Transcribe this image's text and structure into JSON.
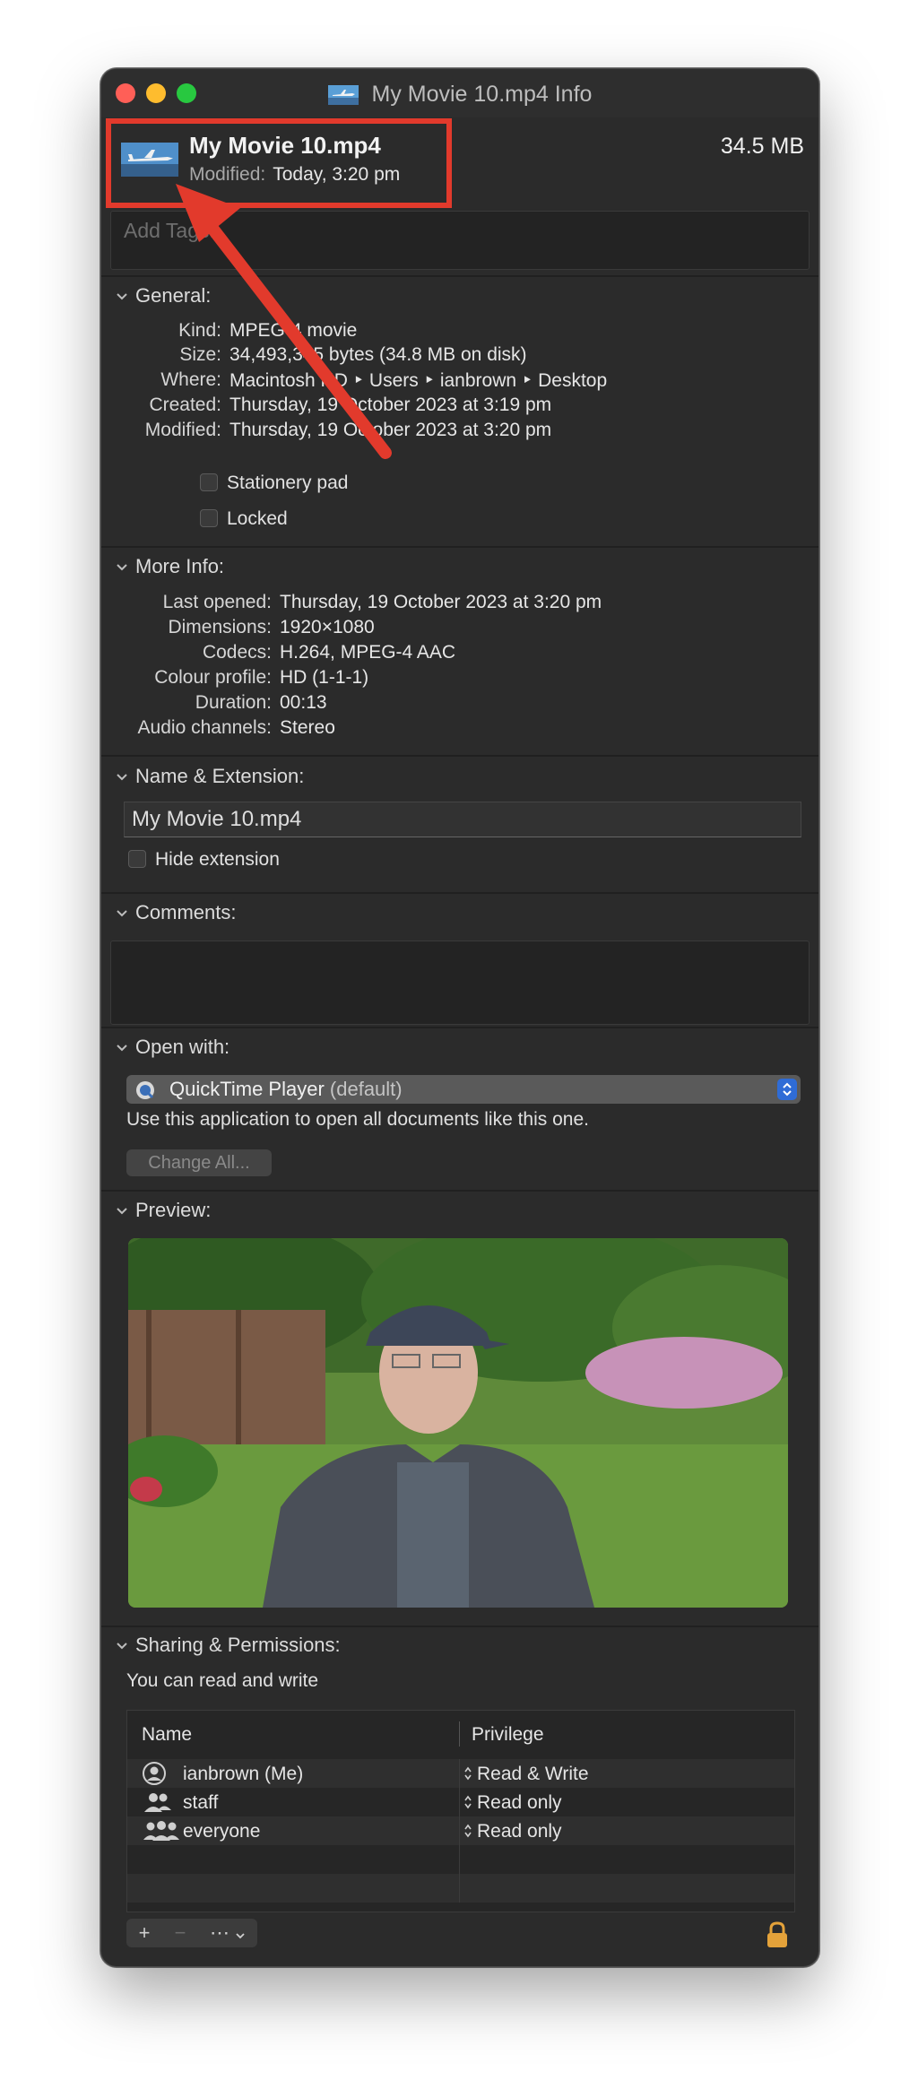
{
  "window": {
    "title": "My Movie 10.mp4 Info",
    "title_icon": "movie-file-icon"
  },
  "header": {
    "filename": "My Movie 10.mp4",
    "modified_label": "Modified:",
    "modified_value": "Today, 3:20 pm",
    "size": "34.5 MB"
  },
  "tags": {
    "placeholder": "Add Tags..."
  },
  "general": {
    "title": "General:",
    "rows": [
      {
        "k": "Kind:",
        "v": "MPEG-4 movie"
      },
      {
        "k": "Size:",
        "v": "34,493,345 bytes (34.8 MB on disk)"
      },
      {
        "k": "Where:",
        "v": "Macintosh HD ‣ Users ‣ ianbrown ‣ Desktop"
      },
      {
        "k": "Created:",
        "v": "Thursday, 19 October 2023 at 3:19 pm"
      },
      {
        "k": "Modified:",
        "v": "Thursday, 19 October 2023 at 3:20 pm"
      }
    ],
    "stationery": "Stationery pad",
    "locked": "Locked"
  },
  "more_info": {
    "title": "More Info:",
    "rows": [
      {
        "k": "Last opened:",
        "v": "Thursday, 19 October 2023 at 3:20 pm"
      },
      {
        "k": "Dimensions:",
        "v": "1920×1080"
      },
      {
        "k": "Codecs:",
        "v": "H.264, MPEG-4 AAC"
      },
      {
        "k": "Colour profile:",
        "v": "HD (1-1-1)"
      },
      {
        "k": "Duration:",
        "v": "00:13"
      },
      {
        "k": "Audio channels:",
        "v": "Stereo"
      }
    ]
  },
  "name_ext": {
    "title": "Name & Extension:",
    "value": "My Movie 10.mp4",
    "hide_extension": "Hide extension"
  },
  "comments": {
    "title": "Comments:"
  },
  "open_with": {
    "title": "Open with:",
    "app": "QuickTime Player",
    "default_tag": "(default)",
    "description": "Use this application to open all documents like this one.",
    "change_all": "Change All..."
  },
  "preview": {
    "title": "Preview:"
  },
  "sharing": {
    "title": "Sharing & Permissions:",
    "summary": "You can read and write",
    "col_name": "Name",
    "col_privilege": "Privilege",
    "rows": [
      {
        "name": "ianbrown (Me)",
        "privilege": "Read & Write",
        "icon": "user-icon"
      },
      {
        "name": "staff",
        "privilege": "Read only",
        "icon": "group-icon"
      },
      {
        "name": "everyone",
        "privilege": "Read only",
        "icon": "everyone-icon"
      }
    ],
    "add": "+",
    "remove": "−",
    "action": "⋯"
  },
  "colors": {
    "window_bg": "#2b2b2b",
    "annotation_red": "#e23a2c",
    "accent_blue": "#2f6cd6"
  }
}
